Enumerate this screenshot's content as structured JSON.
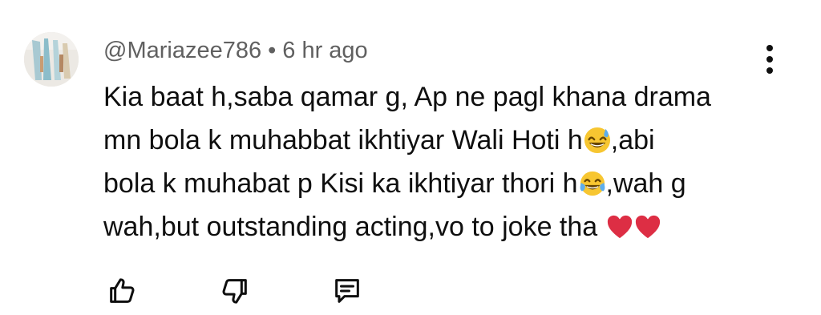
{
  "comment": {
    "author": "@Mariazee786",
    "separator": "•",
    "time": "6 hr ago",
    "lines": [
      {
        "text": "Kia baat h,saba qamar g, Ap ne pagl khana drama"
      },
      {
        "text": "mn bola k muhabbat ikhtiyar Wali Hoti h",
        "emoji": "😅",
        "after": ",abi"
      },
      {
        "text": "bola k muhabat p Kisi ka ikhtiyar thori h",
        "emoji": "😂",
        "after": ",wah g"
      },
      {
        "text": "wah,but outstanding acting,vo to joke tha ",
        "emoji": "❤️❤️"
      }
    ]
  },
  "actions": {
    "like_icon": "thumbs-up-icon",
    "dislike_icon": "thumbs-down-icon",
    "reply_icon": "comment-reply-icon"
  },
  "menu_icon": "more-vertical-icon"
}
